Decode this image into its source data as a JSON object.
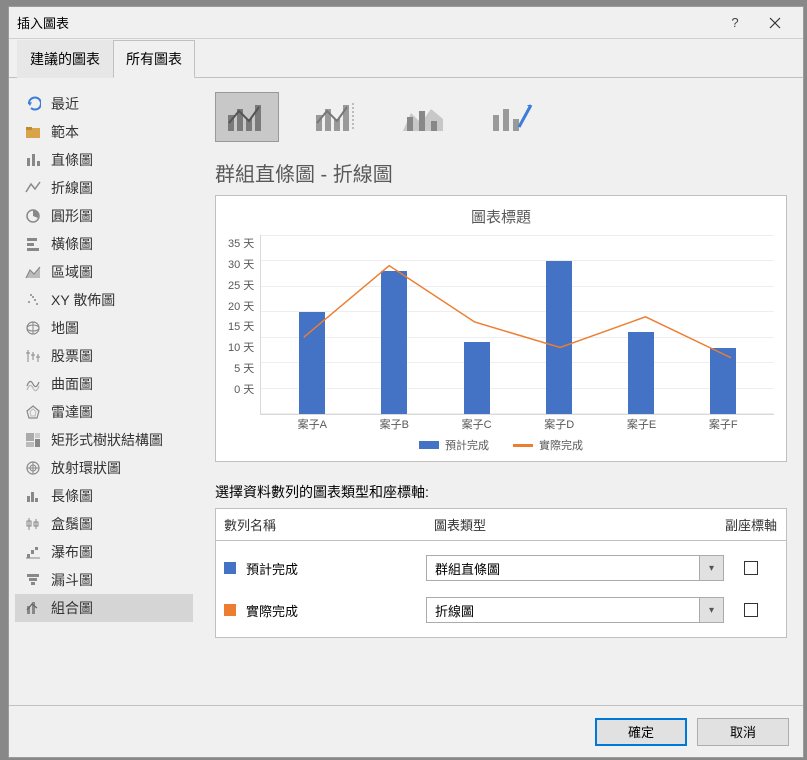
{
  "window": {
    "title": "插入圖表"
  },
  "tabs": {
    "recommended": "建議的圖表",
    "all": "所有圖表"
  },
  "sidebar": {
    "items": [
      {
        "label": "最近"
      },
      {
        "label": "範本"
      },
      {
        "label": "直條圖"
      },
      {
        "label": "折線圖"
      },
      {
        "label": "圓形圖"
      },
      {
        "label": "橫條圖"
      },
      {
        "label": "區域圖"
      },
      {
        "label": "XY 散佈圖"
      },
      {
        "label": "地圖"
      },
      {
        "label": "股票圖"
      },
      {
        "label": "曲面圖"
      },
      {
        "label": "雷達圖"
      },
      {
        "label": "矩形式樹狀結構圖"
      },
      {
        "label": "放射環狀圖"
      },
      {
        "label": "長條圖"
      },
      {
        "label": "盒鬚圖"
      },
      {
        "label": "瀑布圖"
      },
      {
        "label": "漏斗圖"
      },
      {
        "label": "組合圖"
      }
    ]
  },
  "main": {
    "heading": "群組直條圖 - 折線圖",
    "chart_title": "圖表標題",
    "legend": {
      "series1": "預計完成",
      "series2": "實際完成"
    }
  },
  "chart_data": {
    "type": "combo",
    "categories": [
      "案子A",
      "案子B",
      "案子C",
      "案子D",
      "案子E",
      "案子F"
    ],
    "series": [
      {
        "name": "預計完成",
        "type": "bar",
        "values": [
          20,
          28,
          14,
          30,
          16,
          13
        ]
      },
      {
        "name": "實際完成",
        "type": "line",
        "values": [
          15,
          29,
          18,
          13,
          19,
          11
        ]
      }
    ],
    "ylim": [
      0,
      35
    ],
    "y_ticks": [
      "35 天",
      "30 天",
      "25 天",
      "20 天",
      "15 天",
      "10 天",
      "5 天",
      "0 天"
    ],
    "xlabel": "",
    "ylabel": ""
  },
  "series_config": {
    "label": "選擇資料數列的圖表類型和座標軸:",
    "headers": {
      "name": "數列名稱",
      "type": "圖表類型",
      "secondary": "副座標軸"
    },
    "rows": [
      {
        "name": "預計完成",
        "type": "群組直條圖",
        "color": "blue",
        "secondary": false
      },
      {
        "name": "實際完成",
        "type": "折線圖",
        "color": "orange",
        "secondary": false
      }
    ]
  },
  "buttons": {
    "ok": "確定",
    "cancel": "取消"
  }
}
